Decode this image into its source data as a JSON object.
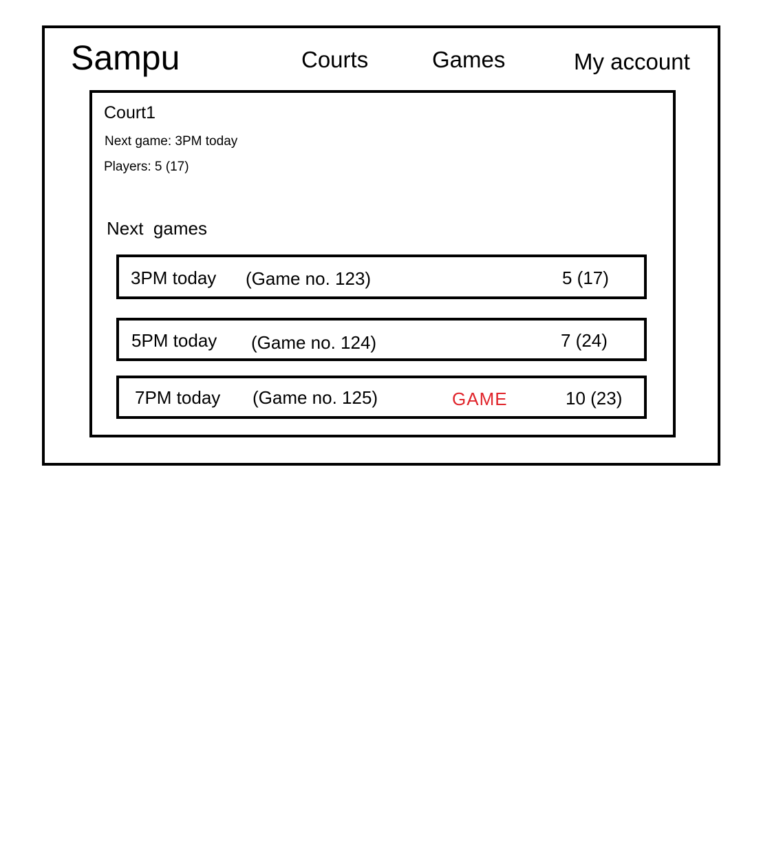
{
  "header": {
    "brand": "Sampu",
    "nav": {
      "courts": "Courts",
      "games": "Games",
      "account": "My account"
    }
  },
  "court": {
    "name": "Court1",
    "next_game": "Next game: 3PM today",
    "players": "Players: 5 (17)"
  },
  "next_games": {
    "heading": "Next  games",
    "rows": [
      {
        "time": "3PM today",
        "game_no": "(Game no. 123)",
        "tag": "",
        "players": "5 (17)"
      },
      {
        "time": "5PM today",
        "game_no": "(Game no. 124)",
        "tag": "",
        "players": "7 (24)"
      },
      {
        "time": "7PM today",
        "game_no": "(Game no. 125)",
        "tag": "GAME",
        "players": "10 (23)"
      }
    ]
  },
  "colors": {
    "border": "#000000",
    "tag": "#e0242b",
    "background": "#ffffff"
  }
}
